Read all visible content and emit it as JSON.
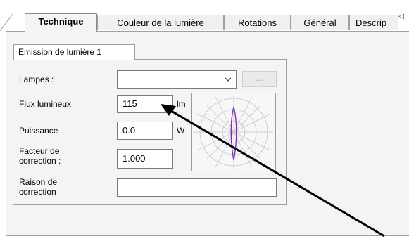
{
  "tabs": [
    {
      "label": "Technique",
      "active": true
    },
    {
      "label": "Couleur de la lumière",
      "active": false
    },
    {
      "label": "Rotations",
      "active": false
    },
    {
      "label": "Général",
      "active": false
    },
    {
      "label": "Descrip",
      "active": false
    }
  ],
  "tab_scroll_icon": "triangle-left-icon",
  "subtab": {
    "label": "Emission de lumière 1"
  },
  "form": {
    "lampes_label": "Lampes :",
    "lampes_value": "",
    "browse_label": "...",
    "flux_label": "Flux lumineux",
    "flux_value": "115",
    "flux_unit": "lm",
    "puissance_label": "Puissance",
    "puissance_value": "0.0",
    "puissance_unit": "W",
    "facteur_label_line1": "Facteur de",
    "facteur_label_line2": "correction :",
    "facteur_value": "1.000",
    "raison_label_line1": "Raison de",
    "raison_label_line2": "correction",
    "raison_value": ""
  },
  "colors": {
    "curve": "#7b2fbf",
    "annotation_arrow": "#000000"
  }
}
